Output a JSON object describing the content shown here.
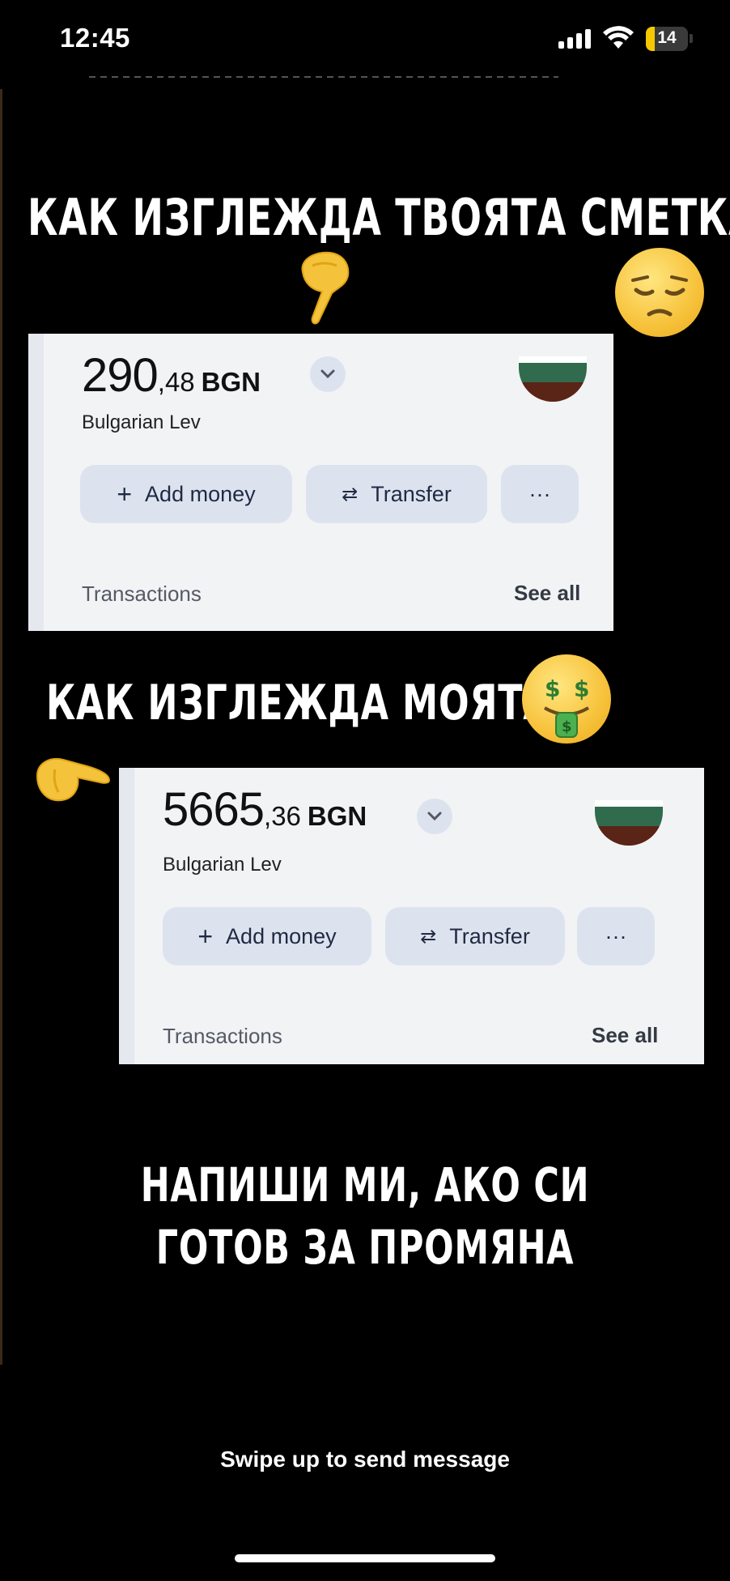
{
  "status_bar": {
    "time": "12:45",
    "battery": "14"
  },
  "story": {
    "heading_1": "КАК ИЗГЛЕЖДА ТВОЯТА СМЕТКА",
    "heading_2": "КАК ИЗГЛЕЖДА МОЯТА",
    "heading_3_line1": "НАПИШИ МИ, АКО СИ",
    "heading_3_line2": "ГОТОВ ЗА ПРОМЯНА"
  },
  "cards": [
    {
      "amount_int": "290",
      "amount_dec": ",48",
      "currency": "BGN",
      "currency_name": "Bulgarian Lev",
      "add_money": "Add money",
      "transfer": "Transfer",
      "more": "···",
      "transactions": "Transactions",
      "see_all": "See all"
    },
    {
      "amount_int": "5665",
      "amount_dec": ",36",
      "currency": "BGN",
      "currency_name": "Bulgarian Lev",
      "add_money": "Add money",
      "transfer": "Transfer",
      "more": "···",
      "transactions": "Transactions",
      "see_all": "See all"
    }
  ],
  "footer": {
    "swipe_text": "Swipe up to send message"
  },
  "icons": [
    "signal-icon",
    "wifi-icon",
    "battery-icon",
    "pointing-hand-icon",
    "pensive-face-icon",
    "money-mouth-face-icon",
    "chevron-down-icon",
    "plus-icon",
    "transfer-arrows-icon",
    "more-icon"
  ],
  "colors": {
    "background": "#000000",
    "card": "#f2f3f5",
    "button": "#dde3ee",
    "emoji": "#f7c23b"
  }
}
